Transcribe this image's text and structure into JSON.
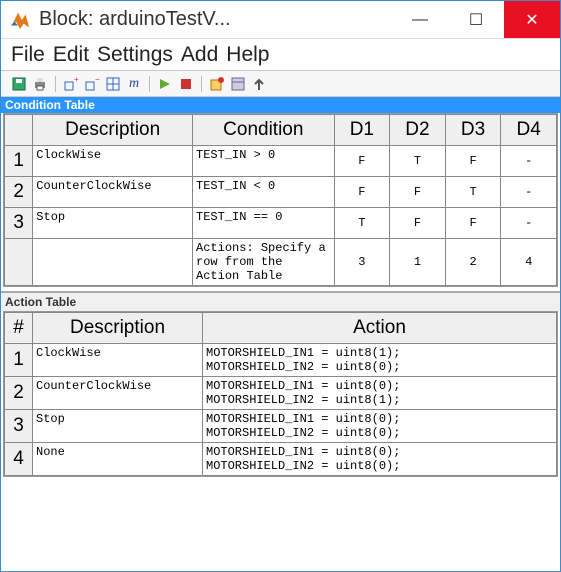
{
  "window": {
    "title": "Block: arduinoTestV...",
    "minimize": "—",
    "maximize": "☐",
    "close": "✕"
  },
  "menu": {
    "file": "File",
    "edit": "Edit",
    "settings": "Settings",
    "add": "Add",
    "help": "Help"
  },
  "section": {
    "condition": "Condition Table",
    "action": "Action Table"
  },
  "condTable": {
    "headers": {
      "desc": "Description",
      "cond": "Condition",
      "d1": "D1",
      "d2": "D2",
      "d3": "D3",
      "d4": "D4"
    },
    "rows": [
      {
        "n": "1",
        "desc": "ClockWise",
        "cond": "TEST_IN > 0",
        "d": [
          "F",
          "T",
          "F",
          "-"
        ]
      },
      {
        "n": "2",
        "desc": "CounterClockWise",
        "cond": "TEST_IN < 0",
        "d": [
          "F",
          "F",
          "T",
          "-"
        ]
      },
      {
        "n": "3",
        "desc": "Stop",
        "cond": "TEST_IN == 0",
        "d": [
          "T",
          "F",
          "F",
          "-"
        ]
      }
    ],
    "footer": {
      "desc": "",
      "cond": "Actions: Specify a row from the Action Table",
      "d": [
        "3",
        "1",
        "2",
        "4"
      ]
    }
  },
  "actTable": {
    "headers": {
      "hash": "#",
      "desc": "Description",
      "action": "Action"
    },
    "rows": [
      {
        "n": "1",
        "desc": "ClockWise",
        "a1": "MOTORSHIELD_IN1 = uint8(1);",
        "a2": "MOTORSHIELD_IN2 = uint8(0);"
      },
      {
        "n": "2",
        "desc": "CounterClockWise",
        "a1": "MOTORSHIELD_IN1 = uint8(0);",
        "a2": "MOTORSHIELD_IN2 = uint8(1);"
      },
      {
        "n": "3",
        "desc": "Stop",
        "a1": "MOTORSHIELD_IN1 = uint8(0);",
        "a2": "MOTORSHIELD_IN2 = uint8(0);"
      },
      {
        "n": "4",
        "desc": "None",
        "a1": "MOTORSHIELD_IN1 = uint8(0);",
        "a2": "MOTORSHIELD_IN2 = uint8(0);"
      }
    ]
  }
}
